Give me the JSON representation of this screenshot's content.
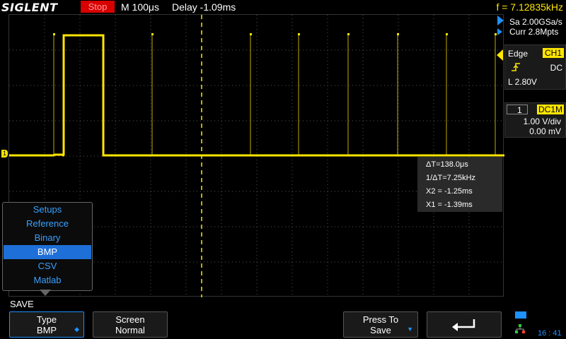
{
  "header": {
    "brand": "SIGLENT",
    "run_state": "Stop",
    "timebase": "M 100μs",
    "delay": "Delay -1.09ms",
    "frequency": "f = 7.12835kHz"
  },
  "acquisition": {
    "sample_rate": "Sa 2.00GSa/s",
    "memory_depth": "Curr 2.8Mpts"
  },
  "trigger": {
    "type": "Edge",
    "source": "CH1",
    "slope_icon": "rising-edge-icon",
    "coupling": "DC",
    "level": "L  2.80V"
  },
  "channel": {
    "number": "1",
    "coupling": "DC1M",
    "volts_per_div": "1.00 V/div",
    "offset": "0.00 mV"
  },
  "cursor_measure": {
    "delta_t": "ΔT=138.0μs",
    "inv_delta_t": "1/ΔT=7.25kHz",
    "x2": "X2 = -1.25ms",
    "x1": "X1 = -1.39ms"
  },
  "popup_menu": {
    "items": [
      "Setups",
      "Reference",
      "Binary",
      "BMP",
      "CSV",
      "Matlab"
    ],
    "selected": "BMP"
  },
  "softkeys": {
    "menu_title": "SAVE",
    "type_label": "Type",
    "type_value": "BMP",
    "screen_label": "Screen",
    "screen_value": "Normal",
    "press_to_label": "Press To",
    "press_to_value": "Save",
    "back_icon": "return-arrow-icon"
  },
  "status": {
    "time": "16 : 41"
  },
  "colors": {
    "channel1": "#ffe600",
    "accent": "#1e90ff",
    "stop": "#d90000"
  }
}
